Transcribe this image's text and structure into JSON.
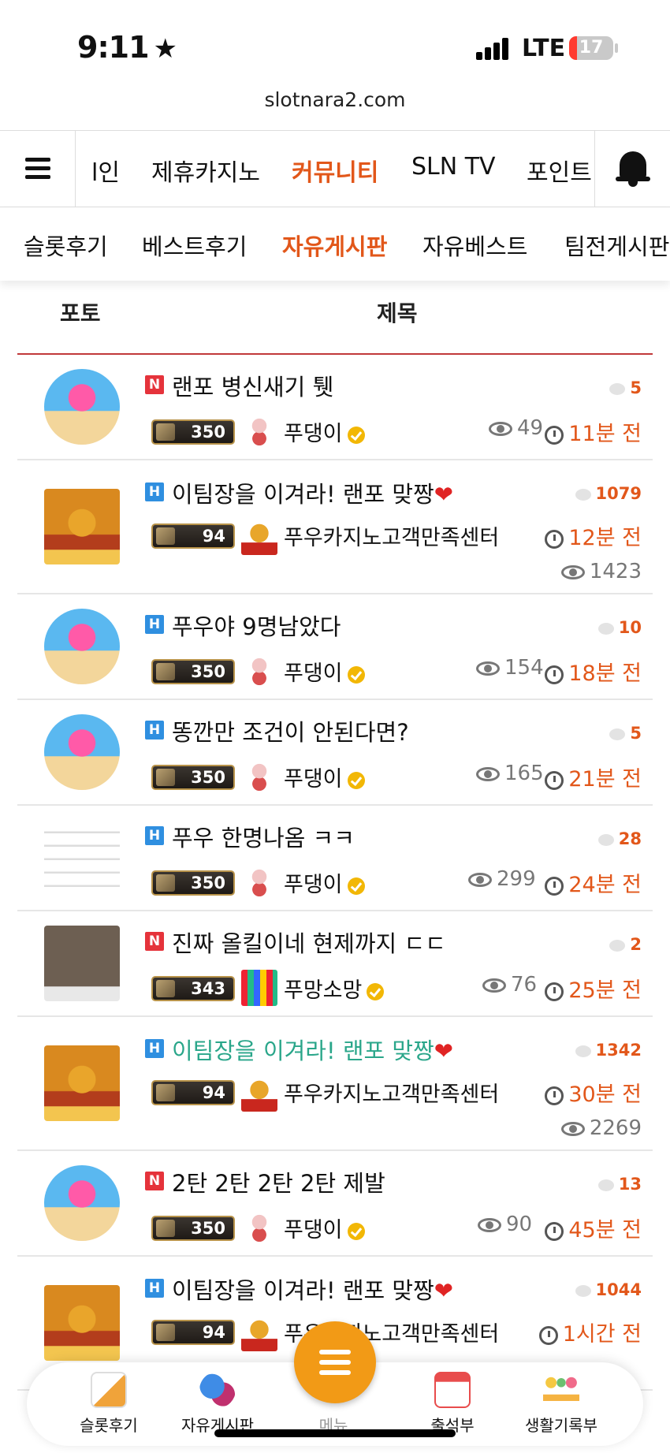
{
  "status_bar": {
    "time": "9:11",
    "time_icon": "★",
    "network": "LTE",
    "battery": "17",
    "battery_level": 0.17
  },
  "browser": {
    "url": "slotnara2.com"
  },
  "main_nav": {
    "items": [
      {
        "label": "l인",
        "active": false
      },
      {
        "label": "제휴카지노",
        "active": false
      },
      {
        "label": "커뮤니티",
        "active": true
      },
      {
        "label": "SLN TV",
        "active": false
      },
      {
        "label": "포인트",
        "active": false
      }
    ]
  },
  "sub_nav": {
    "items": [
      {
        "label": "슬롯후기",
        "active": false
      },
      {
        "label": "베스트후기",
        "active": false
      },
      {
        "label": "자유게시판",
        "active": true
      },
      {
        "label": "자유베스트",
        "active": false
      },
      {
        "label": "팀전게시판",
        "active": false
      }
    ]
  },
  "table": {
    "headers": {
      "photo": "포토",
      "title": "제목"
    },
    "rows": [
      {
        "badge": "N",
        "title": "랜포 병신새기 퉷",
        "heart": "",
        "comments": "5",
        "level": "350",
        "nick": "푸댕이",
        "verified": true,
        "views": "49",
        "time": "11분 전"
      },
      {
        "badge": "H",
        "title": "이팀장을 이겨라! 랜포 맞짱",
        "heart": "❤",
        "comments": "1079",
        "level": "94",
        "nick": "푸우카지노고객만족센터",
        "verified": false,
        "views": "1423",
        "time": "12분 전"
      },
      {
        "badge": "H",
        "title": "푸우야 9명남았다",
        "heart": "",
        "comments": "10",
        "level": "350",
        "nick": "푸댕이",
        "verified": true,
        "views": "154",
        "time": "18분 전"
      },
      {
        "badge": "H",
        "title": "똥깐만 조건이 안된다면?",
        "heart": "",
        "comments": "5",
        "level": "350",
        "nick": "푸댕이",
        "verified": true,
        "views": "165",
        "time": "21분 전"
      },
      {
        "badge": "H",
        "title": "푸우 한명나옴 ㅋㅋ",
        "heart": "",
        "comments": "28",
        "level": "350",
        "nick": "푸댕이",
        "verified": true,
        "views": "299",
        "time": "24분 전"
      },
      {
        "badge": "N",
        "title": "진짜 올킬이네 현제까지 ㄷㄷ",
        "heart": "",
        "comments": "2",
        "level": "343",
        "nick": "푸망소망",
        "verified": true,
        "views": "76",
        "time": "25분 전"
      },
      {
        "badge": "H",
        "title": "이팀장을 이겨라! 랜포 맞짱",
        "heart": "❤",
        "comments": "1342",
        "level": "94",
        "nick": "푸우카지노고객만족센터",
        "verified": false,
        "views": "2269",
        "time": "30분 전"
      },
      {
        "badge": "N",
        "title": "2탄 2탄 2탄 2탄 제발",
        "heart": "",
        "comments": "13",
        "level": "350",
        "nick": "푸댕이",
        "verified": true,
        "views": "90",
        "time": "45분 전"
      },
      {
        "badge": "H",
        "title": "이팀장을 이겨라! 랜포 맞짱",
        "heart": "❤",
        "comments": "1044",
        "level": "94",
        "nick": "푸우카지노고객만족센터",
        "verified": false,
        "views": "",
        "time": "1시간 전"
      }
    ]
  },
  "tab_bar": {
    "items": [
      {
        "label": "슬롯후기",
        "icon": "review-icon"
      },
      {
        "label": "자유게시판",
        "icon": "chat-icon"
      },
      {
        "label": "메뉴",
        "icon": "menu-icon"
      },
      {
        "label": "출석부",
        "icon": "calendar-icon"
      },
      {
        "label": "생활기록부",
        "icon": "record-icon"
      }
    ]
  },
  "colors": {
    "accent": "#e2571a",
    "fab": "#f29a16",
    "header_rule": "#c0393a",
    "visited_link": "#2aa68a"
  }
}
